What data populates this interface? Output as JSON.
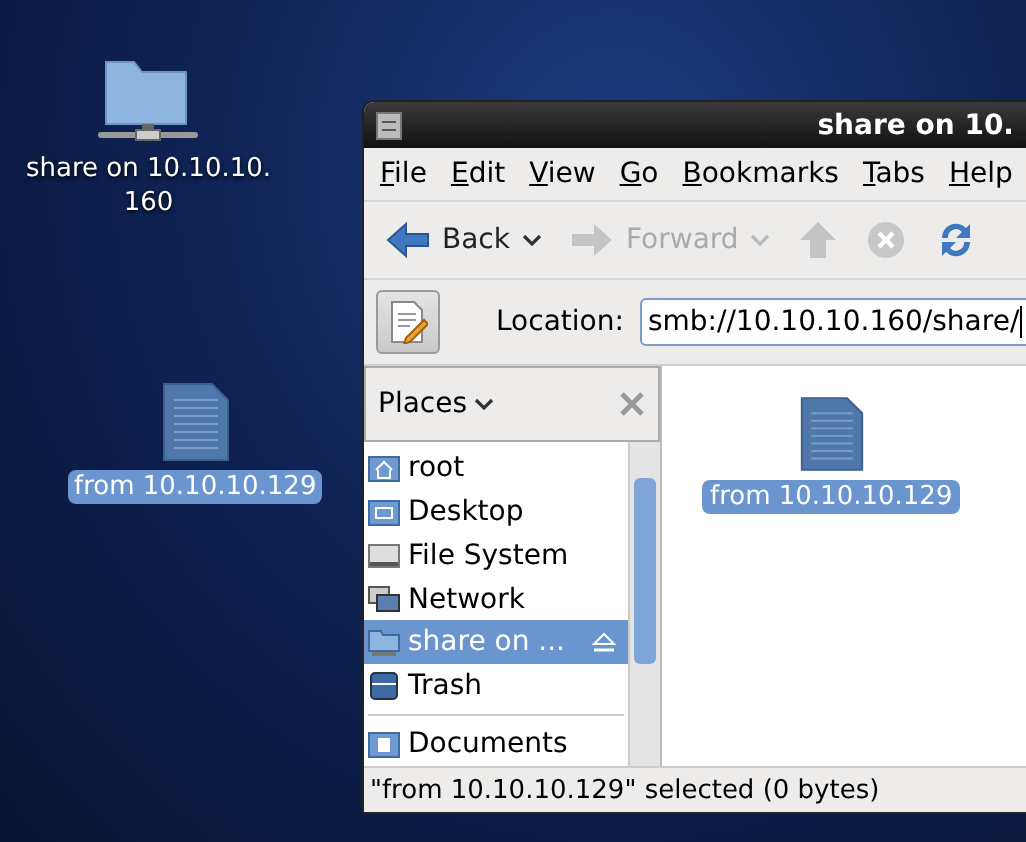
{
  "desktop_icons": [
    {
      "kind": "network-folder",
      "lines": [
        "share on 10.10.10.",
        "160"
      ],
      "selected": false
    },
    {
      "kind": "document",
      "lines": [
        "from 10.10.10.129"
      ],
      "selected": true
    }
  ],
  "window": {
    "title": "share on 10.",
    "menu": [
      "File",
      "Edit",
      "View",
      "Go",
      "Bookmarks",
      "Tabs",
      "Help"
    ],
    "toolbar": [
      {
        "kind": "back",
        "label": "Back",
        "disabled": false,
        "dropdown": true
      },
      {
        "kind": "forward",
        "label": "Forward",
        "disabled": true,
        "dropdown": true
      },
      {
        "kind": "up",
        "disabled": true
      },
      {
        "kind": "stop",
        "disabled": true
      },
      {
        "kind": "reload",
        "disabled": false
      }
    ],
    "location": {
      "label": "Location:",
      "value": "smb://10.10.10.160/share/"
    },
    "sidebar": {
      "title": "Places",
      "items": [
        {
          "kind": "home",
          "label": "root",
          "selected": false
        },
        {
          "kind": "desktop",
          "label": "Desktop",
          "selected": false
        },
        {
          "kind": "drive",
          "label": "File System",
          "selected": false
        },
        {
          "kind": "network",
          "label": "Network",
          "selected": false
        },
        {
          "kind": "share",
          "label": "share on ...",
          "selected": true,
          "eject": true
        },
        {
          "kind": "trash",
          "label": "Trash",
          "selected": false
        },
        {
          "kind": "folder",
          "label": "Documents",
          "selected": false,
          "divider_before": true
        }
      ]
    },
    "files": [
      {
        "kind": "document",
        "label": "from 10.10.10.129",
        "selected": true
      }
    ],
    "status_bar": "\"from 10.10.10.129\" selected (0 bytes)"
  }
}
